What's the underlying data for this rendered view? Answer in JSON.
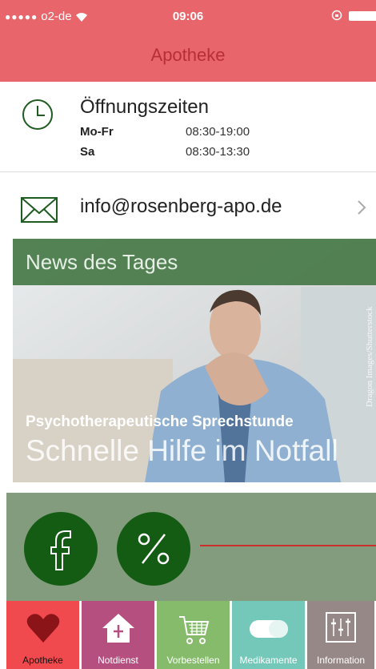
{
  "status": {
    "carrier": "o2-de",
    "signal_dots": "●●●●●",
    "time": "09:06"
  },
  "header": {
    "title": "Apotheke"
  },
  "hours": {
    "title": "Öffnungszeiten",
    "rows": [
      {
        "day": "Mo-Fr",
        "time": "08:30-19:00"
      },
      {
        "day": "Sa",
        "time": "08:30-13:30"
      }
    ]
  },
  "contact": {
    "email": "info@rosenberg-apo.de"
  },
  "news": {
    "heading": "News des Tages",
    "subtitle": "Psychotherapeutische Sprechstunde",
    "headline": "Schnelle Hilfe im Notfall",
    "credit": "Dragon Images/Shutterstock"
  },
  "social": {
    "facebook_icon": "facebook-icon",
    "discount_icon": "percent-icon"
  },
  "tabs": [
    {
      "label": "Apotheke",
      "icon": "heart-icon"
    },
    {
      "label": "Notdienst",
      "icon": "pharmacy-house-icon"
    },
    {
      "label": "Vorbestellen",
      "icon": "shopping-cart-icon"
    },
    {
      "label": "Medikamente",
      "icon": "pill-icon"
    },
    {
      "label": "Information",
      "icon": "sliders-icon"
    }
  ],
  "colors": {
    "header": "#e8666b",
    "title": "#b82e36",
    "news_bar": "#46784a",
    "social_bg": "#839c7d",
    "social_circle": "#145c14",
    "tab_apotheke": "#f04a4e",
    "tab_notdienst": "#b54f7f",
    "tab_vorbestellen": "#85bb6a",
    "tab_medikamente": "#74c8b9",
    "tab_information": "#968886"
  }
}
